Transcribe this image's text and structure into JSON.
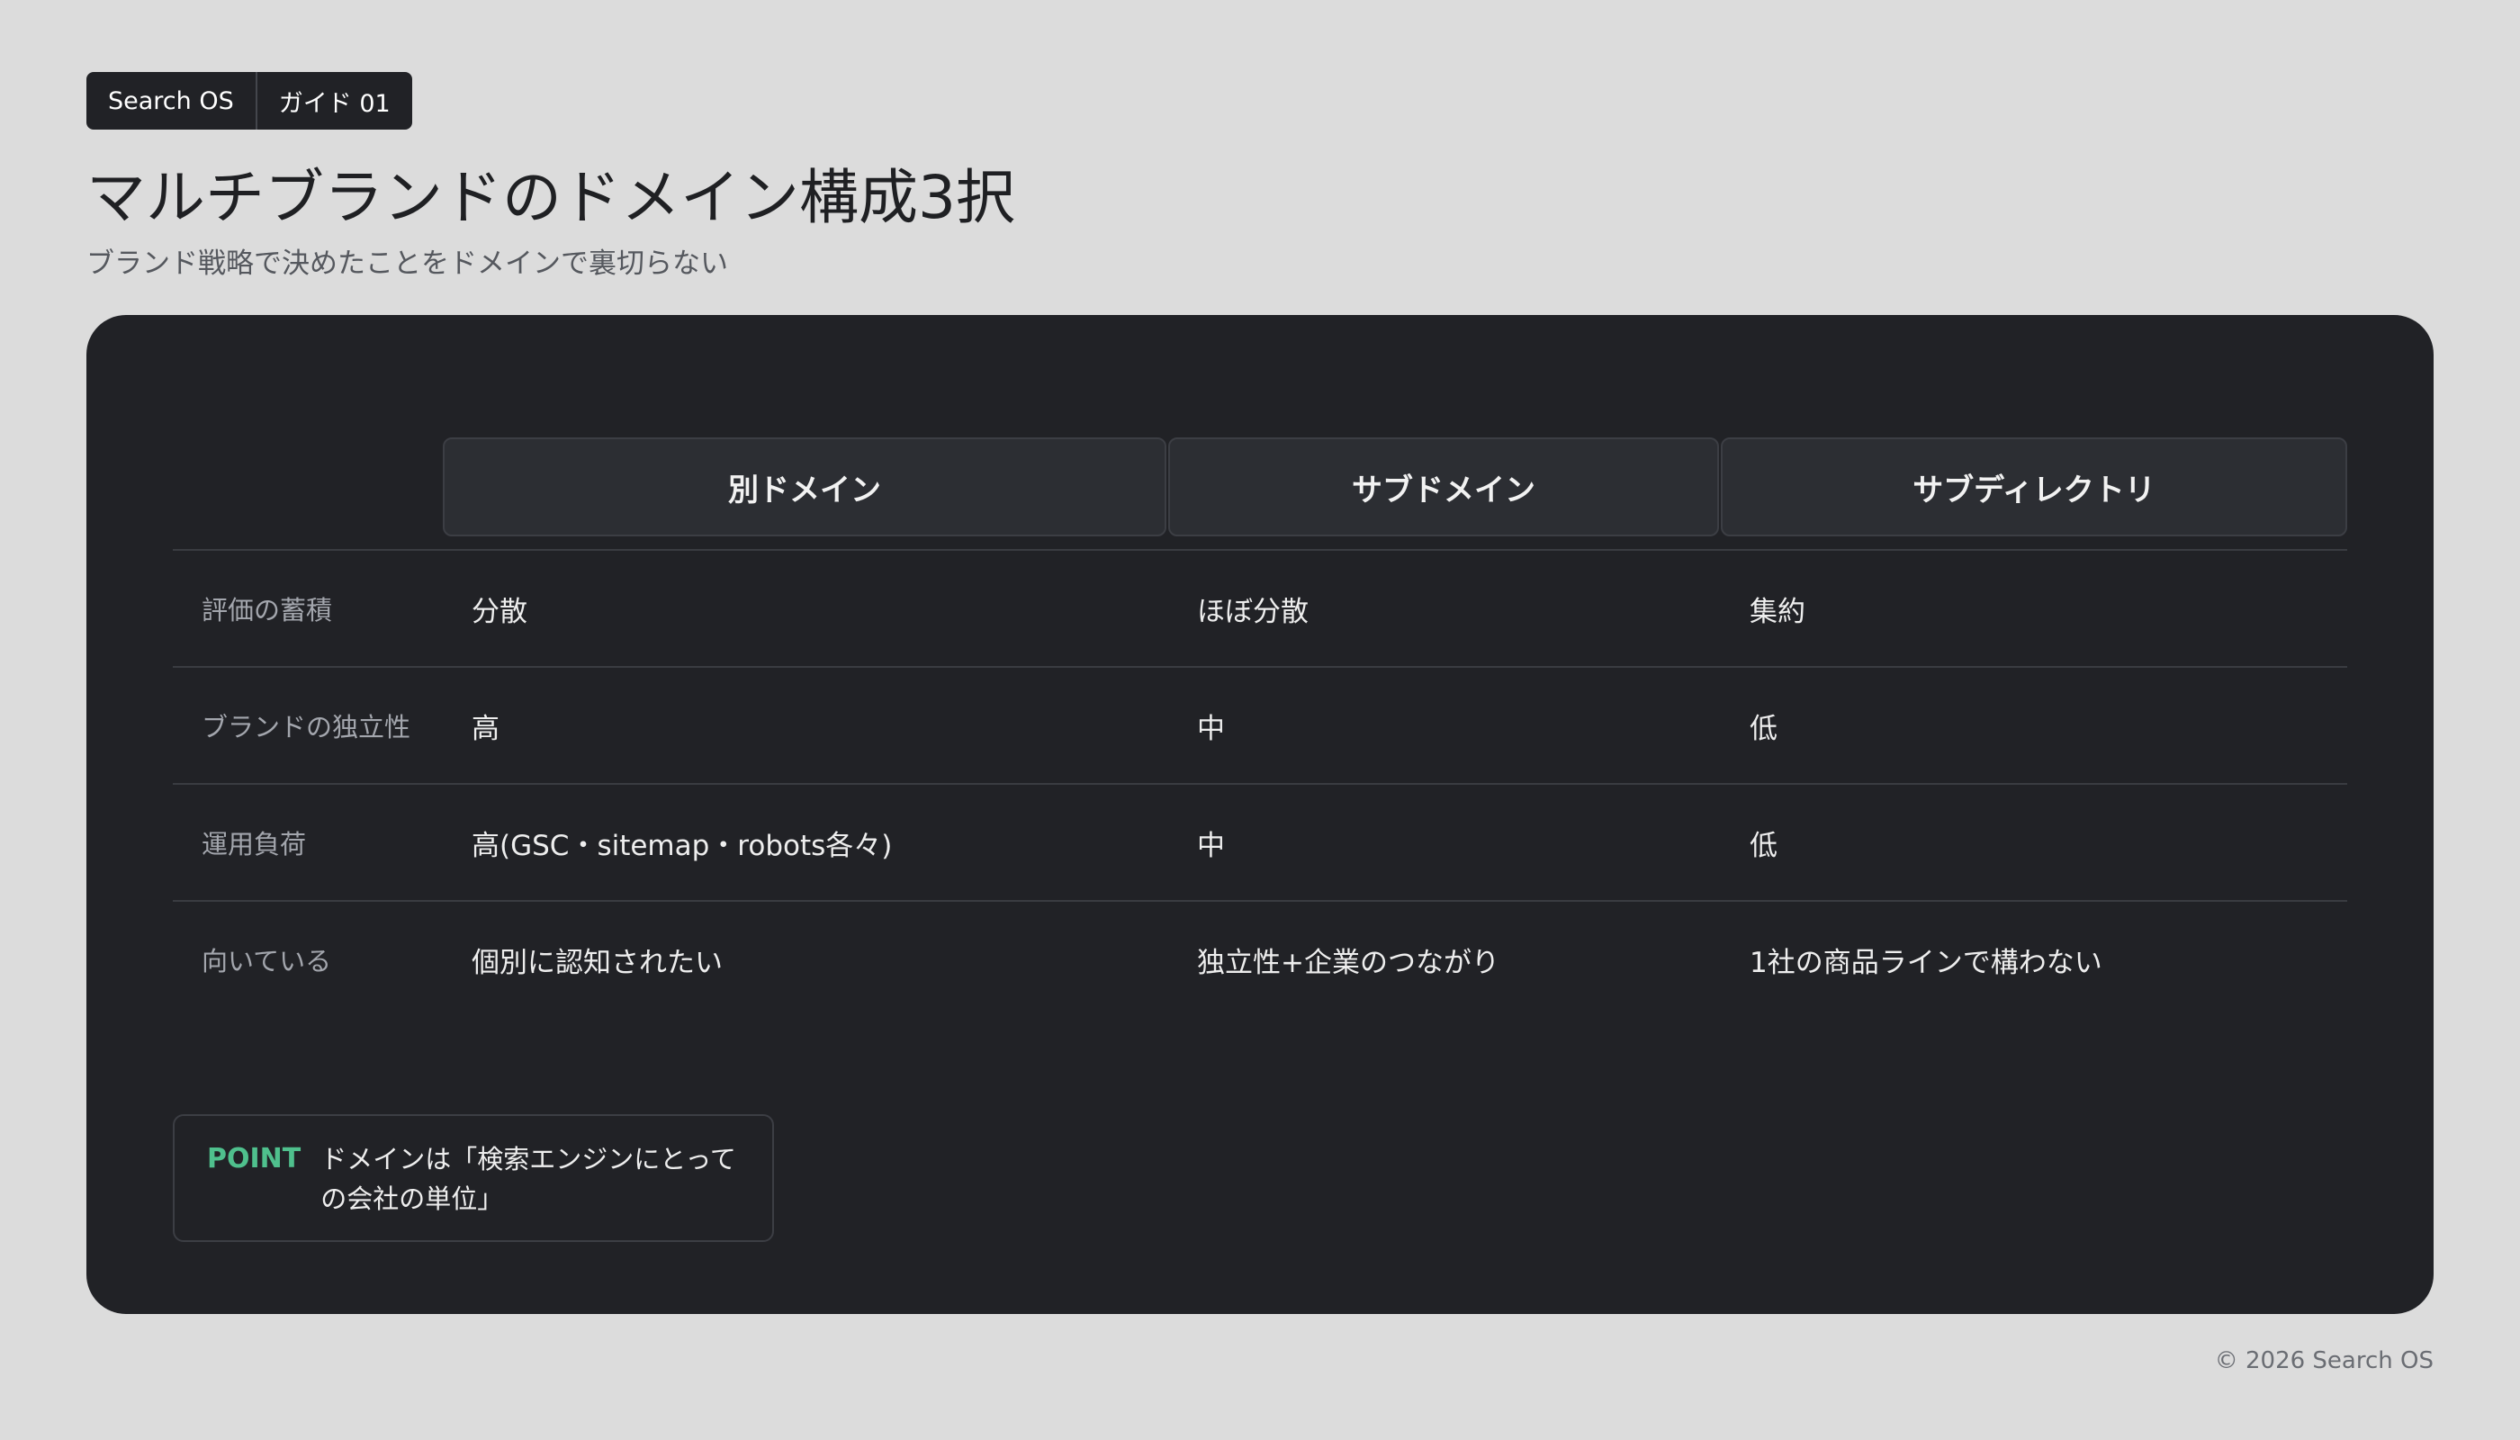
{
  "header": {
    "tag_brand": "Search OS",
    "tag_label": "ガイド 01",
    "title": "マルチブランドのドメイン構成3択",
    "subtitle": "ブランド戦略で決めたことをドメインで裏切らない"
  },
  "table": {
    "columns": [
      "別ドメイン",
      "サブドメイン",
      "サブディレクトリ"
    ],
    "rows": [
      {
        "label": "評価の蓄積",
        "values": [
          "分散",
          "ほぼ分散",
          "集約"
        ]
      },
      {
        "label": "ブランドの独立性",
        "values": [
          "高",
          "中",
          "低"
        ]
      },
      {
        "label": "運用負荷",
        "values": [
          "高(GSC・sitemap・robots各々)",
          "中",
          "低"
        ]
      },
      {
        "label": "向いている",
        "values": [
          "個別に認知されたい",
          "独立性+企業のつながり",
          "1社の商品ラインで構わない"
        ]
      }
    ]
  },
  "point": {
    "label": "POINT",
    "text": "ドメインは「検索エンジンにとっての会社の単位」"
  },
  "footer": {
    "copyright": "© 2026 Search OS"
  }
}
